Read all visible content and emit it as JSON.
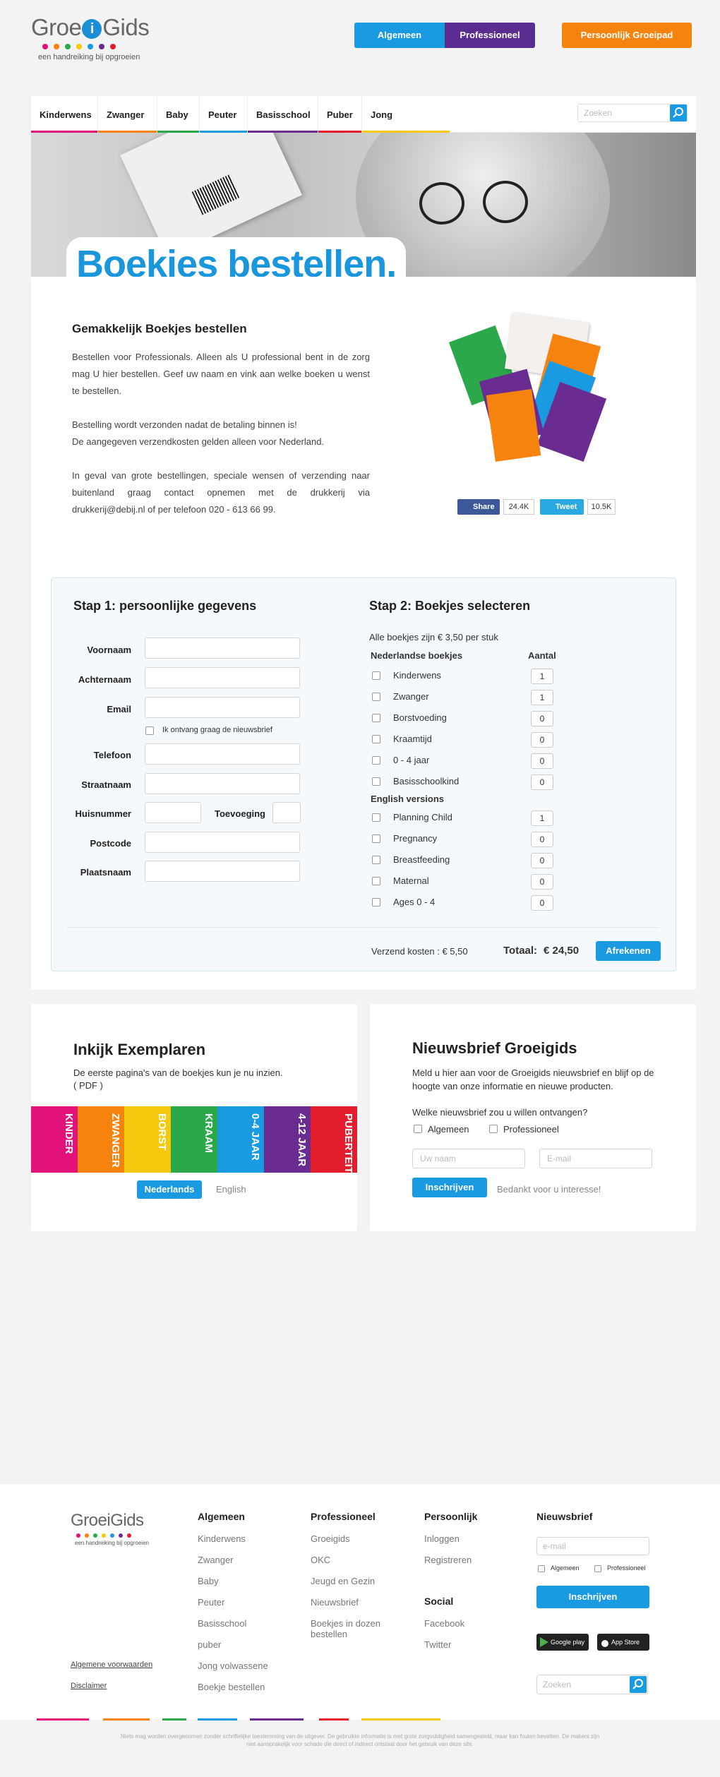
{
  "logo": {
    "text_pre": "Groe",
    "text_i": "i",
    "text_post": "Gids",
    "tagline": "een handreiking bij opgroeien"
  },
  "top_buttons": {
    "algemeen": "Algemeen",
    "professioneel": "Professioneel",
    "groeipad": "Persoonlijk Groeipad"
  },
  "colors": {
    "accent": "#1a9ae0",
    "purple": "#5b2d91",
    "orange": "#f7830f"
  },
  "nav": {
    "items": [
      "Kinderwens",
      "Zwanger",
      "Baby",
      "Peuter",
      "Basisschool",
      "Puber",
      "Jong volwassene"
    ],
    "bar_colors": [
      "#e2127a",
      "#f7830f",
      "#2ba84a",
      "#1a9ae0",
      "#6a2c91",
      "#e41d2d",
      "#f6c90e"
    ],
    "search_placeholder": "Zoeken"
  },
  "hero": {
    "title": "Boekjes bestellen."
  },
  "intro": {
    "heading": "Gemakkelijk Boekjes bestellen",
    "p1": "Bestellen voor Professionals. Alleen als U professional bent in de zorg mag U hier bestellen. Geef uw naam en vink aan welke boeken u wenst te bestellen.",
    "p2a": "Bestelling wordt verzonden nadat de betaling binnen is!",
    "p2b": "De aangegeven verzendkosten gelden alleen voor Nederland.",
    "p3": "In geval van grote bestellingen, speciale wensen of verzending naar buitenland graag contact opnemen met de drukkerij via drukkerij@debij.nl of per telefoon 020 - 613 66 99."
  },
  "social": {
    "share": "Share",
    "share_count": "24.4K",
    "tweet": "Tweet",
    "tweet_count": "10.5K"
  },
  "step1": {
    "title": "Stap 1: persoonlijke gegevens",
    "voornaam": "Voornaam",
    "achternaam": "Achternaam",
    "email": "Email",
    "newsletter": "Ik ontvang graag de nieuwsbrief",
    "telefoon": "Telefoon",
    "straatnaam": "Straatnaam",
    "huisnummer": "Huisnummer",
    "toevoeging": "Toevoeging",
    "postcode": "Postcode",
    "plaatsnaam": "Plaatsnaam"
  },
  "step2": {
    "title": "Stap 2: Boekjes selecteren",
    "price_note": "Alle boekjes zijn  € 3,50 per stuk",
    "nl_heading": "Nederlandse boekjes",
    "qty_heading": "Aantal",
    "nl_books": [
      {
        "name": "Kinderwens",
        "qty": "1"
      },
      {
        "name": "Zwanger",
        "qty": "1"
      },
      {
        "name": "Borstvoeding",
        "qty": "0"
      },
      {
        "name": "Kraamtijd",
        "qty": "0"
      },
      {
        "name": "0 - 4 jaar",
        "qty": "0"
      },
      {
        "name": "Basisschoolkind",
        "qty": "0"
      }
    ],
    "en_heading": "English versions",
    "en_books": [
      {
        "name": "Planning Child",
        "qty": "1"
      },
      {
        "name": "Pregnancy",
        "qty": "0"
      },
      {
        "name": "Breastfeeding",
        "qty": "0"
      },
      {
        "name": "Maternal",
        "qty": "0"
      },
      {
        "name": "Ages 0 - 4",
        "qty": "0"
      }
    ],
    "shipping": "Verzend kosten :  € 5,50",
    "total_label": "Totaal:",
    "total_value": "€ 24,50",
    "checkout": "Afrekenen"
  },
  "inkijk": {
    "title": "Inkijk Exemplaren",
    "text": "De eerste pagina's van de boekjes kun je nu inzien.",
    "pdf": "( PDF )",
    "strip_labels": [
      "KINDER",
      "ZWANGER",
      "BORST",
      "KRAAM",
      "0-4 JAAR",
      "4-12 JAAR",
      "PUBERTEIT"
    ],
    "strip_colors": [
      "#e2127a",
      "#f7830f",
      "#f6c90e",
      "#2ba84a",
      "#1a9ae0",
      "#6a2c91",
      "#e41d2d"
    ],
    "lang_nl": "Nederlands",
    "lang_en": "English"
  },
  "newsletter": {
    "title": "Nieuwsbrief Groeigids",
    "text": "Meld u hier aan voor de Groeigids nieuwsbrief en blijf op de hoogte van onze informatie en nieuwe producten.",
    "question": "Welke nieuwsbrief zou u willen ontvangen?",
    "opt1": "Algemeen",
    "opt2": "Professioneel",
    "name_placeholder": "Uw naam",
    "email_placeholder": "E-mail",
    "submit": "Inschrijven",
    "thanks": "Bedankt voor u interesse!"
  },
  "footer": {
    "col_algemeen": {
      "title": "Algemeen",
      "links": [
        "Kinderwens",
        "Zwanger",
        "Baby",
        "Peuter",
        "Basisschool",
        "puber",
        "Jong volwassene",
        "Boekje bestellen"
      ]
    },
    "col_prof": {
      "title": "Professioneel",
      "links": [
        "Groeigids",
        "OKC",
        "Jeugd en Gezin",
        "Nieuwsbrief",
        "Boekjes in dozen bestellen"
      ]
    },
    "col_pers": {
      "title": "Persoonlijk",
      "links": [
        "Inloggen",
        "Registreren"
      ]
    },
    "col_social": {
      "title": "Social",
      "links": [
        "Facebook",
        "Twitter"
      ]
    },
    "col_news": {
      "title": "Nieuwsbrief",
      "email_placeholder": "e-mail",
      "opt1": "Algemeen",
      "opt2": "Professioneel",
      "submit": "Inschrijven"
    },
    "google_play": "Google play",
    "app_store": "App Store",
    "search_placeholder": "Zoeken",
    "terms": "Algemene voorwaarden",
    "disclaimer": "Disclaimer",
    "copyright": "Niets mag worden overgenomen zonder schriftelijke toestemming van de uitgever. De gebruikte informatie is met grote zorgvuldigheid samengesteld, maar kan fouten bevatten. De makers zijn niet aansprakelijk voor schade die direct of indirect ontstaat door het gebruik van deze site."
  }
}
